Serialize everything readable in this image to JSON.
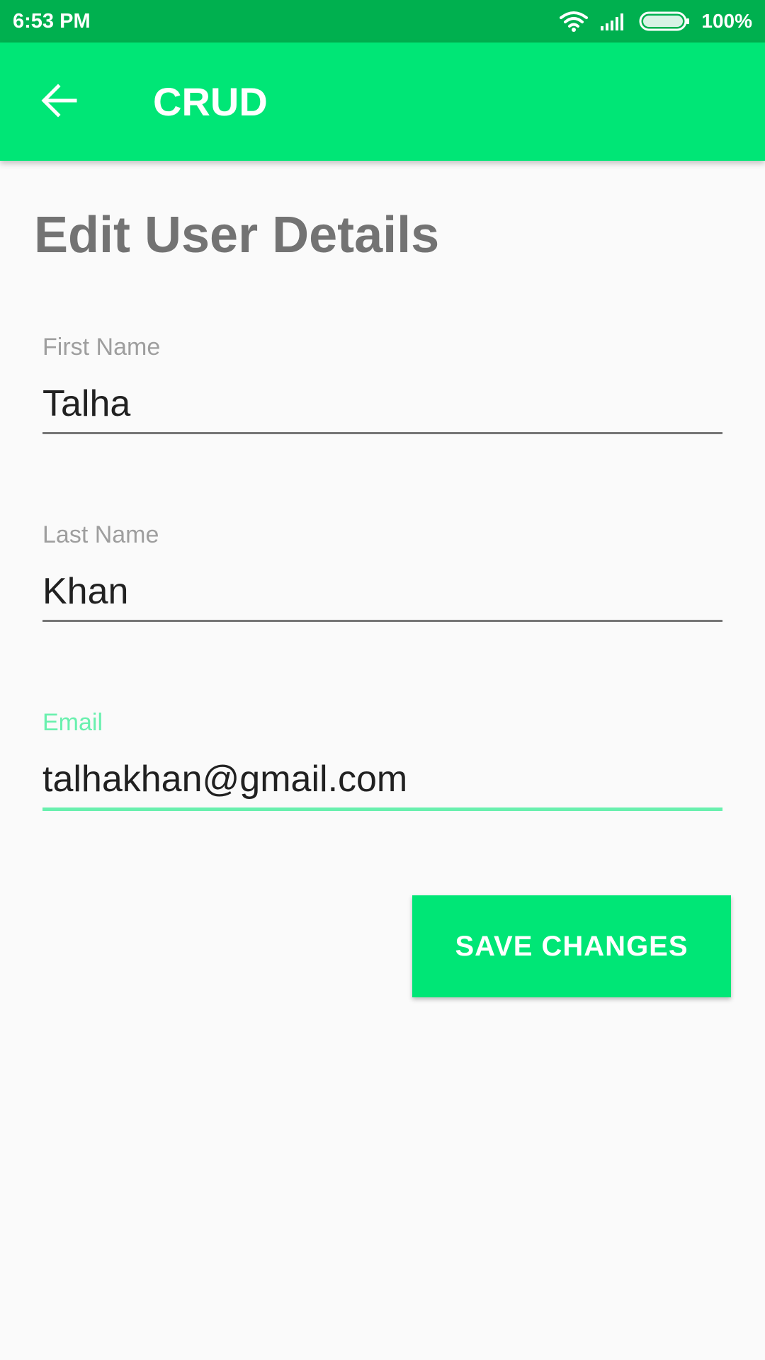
{
  "status_bar": {
    "time": "6:53 PM",
    "battery": "100%",
    "icons": [
      "wifi-icon",
      "signal-icon",
      "battery-icon"
    ]
  },
  "app_bar": {
    "title": "CRUD",
    "back_icon": "arrow-back-icon"
  },
  "page": {
    "title": "Edit User Details"
  },
  "form": {
    "first_name": {
      "label": "First Name",
      "value": "Talha"
    },
    "last_name": {
      "label": "Last Name",
      "value": "Khan"
    },
    "email": {
      "label": "Email",
      "value": "talhakhan@gmail.com",
      "focused": true
    }
  },
  "actions": {
    "save_label": "SAVE CHANGES"
  },
  "colors": {
    "primary": "#00e676",
    "primary_dark": "#00b04f",
    "accent": "#69f0ae",
    "title_gray": "#737373"
  }
}
